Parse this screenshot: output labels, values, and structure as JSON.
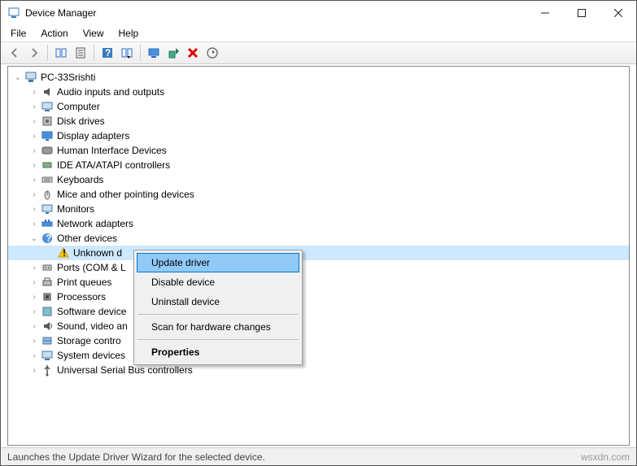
{
  "window": {
    "title": "Device Manager"
  },
  "menu": {
    "file": "File",
    "action": "Action",
    "view": "View",
    "help": "Help"
  },
  "tree": {
    "root": "PC-33Srishti",
    "items": [
      {
        "label": "Audio inputs and outputs",
        "icon": "audio"
      },
      {
        "label": "Computer",
        "icon": "computer"
      },
      {
        "label": "Disk drives",
        "icon": "disk"
      },
      {
        "label": "Display adapters",
        "icon": "display"
      },
      {
        "label": "Human Interface Devices",
        "icon": "hid"
      },
      {
        "label": "IDE ATA/ATAPI controllers",
        "icon": "ide"
      },
      {
        "label": "Keyboards",
        "icon": "keyboard"
      },
      {
        "label": "Mice and other pointing devices",
        "icon": "mouse"
      },
      {
        "label": "Monitors",
        "icon": "monitor"
      },
      {
        "label": "Network adapters",
        "icon": "network"
      },
      {
        "label": "Other devices",
        "icon": "other",
        "expanded": true,
        "children": [
          {
            "label": "Unknown device",
            "icon": "warning",
            "selected": true,
            "truncated": "Unknown d"
          }
        ]
      },
      {
        "label": "Ports (COM & LPT)",
        "icon": "port",
        "truncated": "Ports (COM & L"
      },
      {
        "label": "Print queues",
        "icon": "printer"
      },
      {
        "label": "Processors",
        "icon": "cpu"
      },
      {
        "label": "Software devices",
        "icon": "software",
        "truncated": "Software device"
      },
      {
        "label": "Sound, video and game controllers",
        "icon": "sound",
        "truncated": "Sound, video an"
      },
      {
        "label": "Storage controllers",
        "icon": "storage",
        "truncated": "Storage contro"
      },
      {
        "label": "System devices",
        "icon": "system"
      },
      {
        "label": "Universal Serial Bus controllers",
        "icon": "usb"
      }
    ]
  },
  "context_menu": {
    "update": "Update driver",
    "disable": "Disable device",
    "uninstall": "Uninstall device",
    "scan": "Scan for hardware changes",
    "properties": "Properties"
  },
  "status": {
    "text": "Launches the Update Driver Wizard for the selected device.",
    "watermark": "wsxdn.com"
  }
}
